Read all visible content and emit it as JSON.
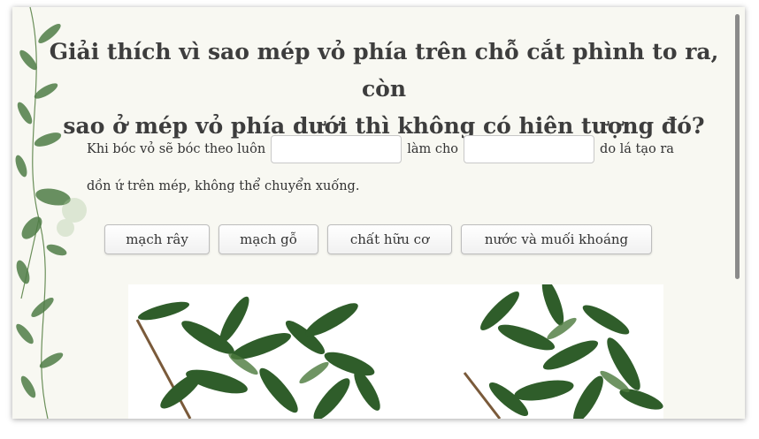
{
  "question": {
    "title_line1": "Giải thích vì sao mép vỏ phía trên chỗ cắt phình to ra, còn",
    "title_line2": "sao ở mép vỏ phía dưới thì không có hiện tượng đó?"
  },
  "sentence": {
    "part1": "Khi bóc vỏ sẽ bóc theo luôn",
    "part2": "làm cho",
    "part3": "do lá tạo ra",
    "part4": "dồn ứ trên mép, không thể chuyển xuống."
  },
  "choices": [
    "mạch rây",
    "mạch gỗ",
    "chất hữu cơ",
    "nước và muối khoáng"
  ],
  "colors": {
    "background": "#f8f8f2",
    "title": "#3d3d3d",
    "leaf_green": "#2f5d2a"
  }
}
